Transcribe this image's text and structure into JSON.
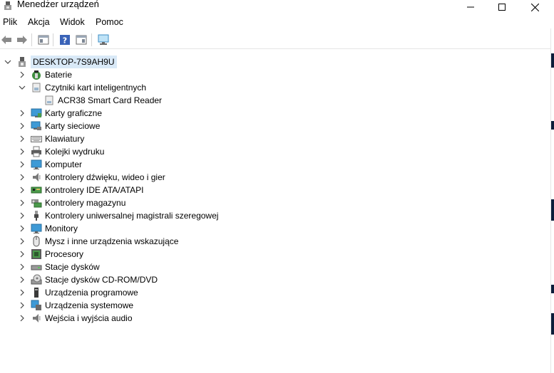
{
  "window": {
    "title": "Menedżer urządzeń",
    "icon": "device-manager-icon"
  },
  "menu": [
    "Plik",
    "Akcja",
    "Widok",
    "Pomoc"
  ],
  "toolbar": {
    "icons": [
      "back-arrow-icon",
      "forward-arrow-icon",
      "properties-icon",
      "help-icon",
      "view-icon",
      "monitor-scan-icon"
    ]
  },
  "tree": {
    "root": {
      "label": "DESKTOP-7S9AH9U",
      "icon": "computer-icon",
      "expanded": true
    },
    "categories": [
      {
        "label": "Baterie",
        "icon": "battery-icon",
        "expanded": false
      },
      {
        "label": "Czytniki kart inteligentnych",
        "icon": "smart-card-reader-icon",
        "expanded": true,
        "children": [
          {
            "label": "ACR38 Smart Card Reader",
            "icon": "card-reader-icon"
          }
        ]
      },
      {
        "label": "Karty graficzne",
        "icon": "display-adapter-icon",
        "expanded": false
      },
      {
        "label": "Karty sieciowe",
        "icon": "network-adapter-icon",
        "expanded": false
      },
      {
        "label": "Klawiatury",
        "icon": "keyboard-icon",
        "expanded": false
      },
      {
        "label": "Kolejki wydruku",
        "icon": "printer-icon",
        "expanded": false
      },
      {
        "label": "Komputer",
        "icon": "monitor-icon",
        "expanded": false
      },
      {
        "label": "Kontrolery dźwięku, wideo i gier",
        "icon": "speaker-icon",
        "expanded": false
      },
      {
        "label": "Kontrolery IDE ATA/ATAPI",
        "icon": "ide-controller-icon",
        "expanded": false
      },
      {
        "label": "Kontrolery magazynu",
        "icon": "storage-controller-icon",
        "expanded": false
      },
      {
        "label": "Kontrolery uniwersalnej magistrali szeregowej",
        "icon": "usb-icon",
        "expanded": false
      },
      {
        "label": "Monitory",
        "icon": "monitor-icon",
        "expanded": false
      },
      {
        "label": "Mysz i inne urządzenia wskazujące",
        "icon": "mouse-icon",
        "expanded": false
      },
      {
        "label": "Procesory",
        "icon": "processor-icon",
        "expanded": false
      },
      {
        "label": "Stacje dysków",
        "icon": "disk-drive-icon",
        "expanded": false
      },
      {
        "label": "Stacje dysków CD-ROM/DVD",
        "icon": "cdrom-icon",
        "expanded": false
      },
      {
        "label": "Urządzenia programowe",
        "icon": "software-device-icon",
        "expanded": false
      },
      {
        "label": "Urządzenia systemowe",
        "icon": "system-devices-icon",
        "expanded": false
      },
      {
        "label": "Wejścia i wyjścia audio",
        "icon": "audio-io-icon",
        "expanded": false
      }
    ]
  }
}
